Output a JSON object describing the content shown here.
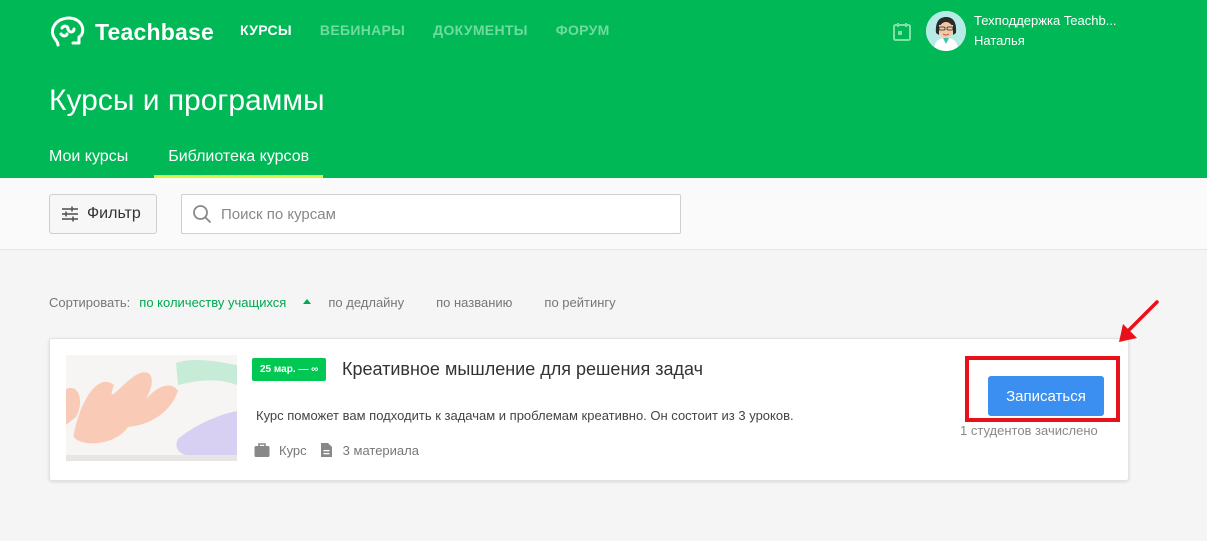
{
  "brand": {
    "name": "Teachbase",
    "primary_color": "#00b956",
    "accent_underline": "#d8f541"
  },
  "nav": [
    {
      "label": "КУРСЫ",
      "active": true
    },
    {
      "label": "ВЕБИНАРЫ",
      "active": false
    },
    {
      "label": "ДОКУМЕНТЫ",
      "active": false
    },
    {
      "label": "ФОРУМ",
      "active": false
    }
  ],
  "user": {
    "name": "Техподдержка Teachb...",
    "subtitle": "Наталья",
    "calendar_icon": "calendar-icon"
  },
  "page": {
    "title": "Курсы и программы",
    "tabs": [
      {
        "label": "Мои курсы",
        "active": false
      },
      {
        "label": "Библиотека курсов",
        "active": true
      }
    ]
  },
  "toolbar": {
    "filter_label": "Фильтр",
    "search_placeholder": "Поиск по курсам",
    "search_value": ""
  },
  "sort": {
    "label": "Сортировать:",
    "options": [
      {
        "label": "по количеству учащихся",
        "active": true,
        "direction": "asc"
      },
      {
        "label": "по дедлайну",
        "active": false
      },
      {
        "label": "по названию",
        "active": false
      },
      {
        "label": "по рейтингу",
        "active": false
      }
    ]
  },
  "course": {
    "badge": "25 мар. — ∞",
    "title": "Креативное мышление для решения задач",
    "description": "Курс поможет вам подходить к задачам и проблемам креативно. Он состоит из 3 уроков.",
    "type": "Курс",
    "materials": "3 материала",
    "enroll_label": "Записаться",
    "enrolled_text": "1 студентов зачислено",
    "button_color": "#3a8ff0"
  },
  "annotation": {
    "highlight_color": "#e8101b"
  }
}
